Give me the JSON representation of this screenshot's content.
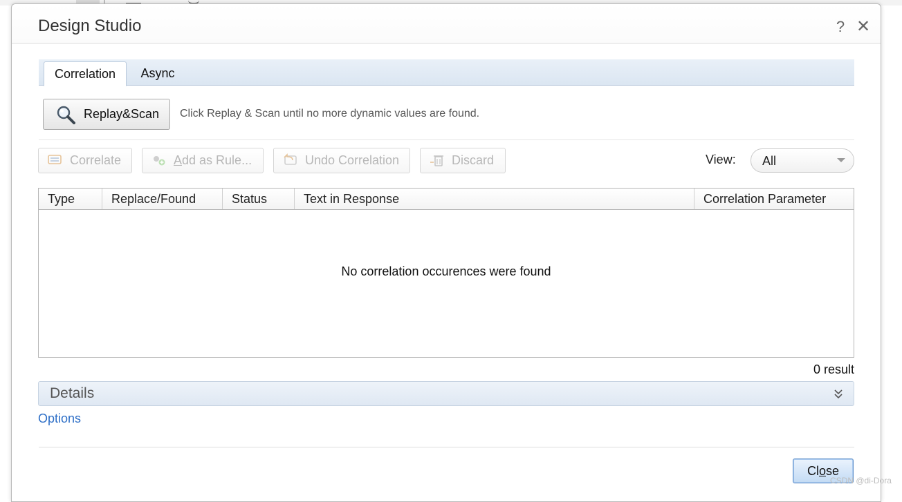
{
  "dialog": {
    "title": "Design Studio",
    "help_icon": "?",
    "close_icon": "✕"
  },
  "tabs": [
    {
      "label": "Correlation",
      "active": true
    },
    {
      "label": "Async",
      "active": false
    }
  ],
  "scan": {
    "button_label": "Replay&Scan",
    "hint": "Click Replay & Scan until no more dynamic values are found."
  },
  "toolbar": {
    "correlate_label": "Correlate",
    "add_rule_label_underlined": "A",
    "add_rule_label_rest": "dd as Rule...",
    "undo_label": "Undo Correlation",
    "discard_label": "Discard",
    "view_label": "View:",
    "view_value": "All"
  },
  "table": {
    "columns": [
      "Type",
      "Replace/Found",
      "Status",
      "Text in Response",
      "Correlation Parameter"
    ],
    "rows": [],
    "empty_message": "No correlation occurences were found"
  },
  "result_count": "0 result",
  "details": {
    "label": "Details"
  },
  "options_label": "Options",
  "footer": {
    "close_label_pre": "Cl",
    "close_label_ul": "o",
    "close_label_post": "se"
  },
  "watermark": "CSDN @di-Dora",
  "colors": {
    "accent": "#2e6fc7",
    "tab_bar": "#dbe6f2",
    "disabled_text": "#b7b7b7"
  }
}
